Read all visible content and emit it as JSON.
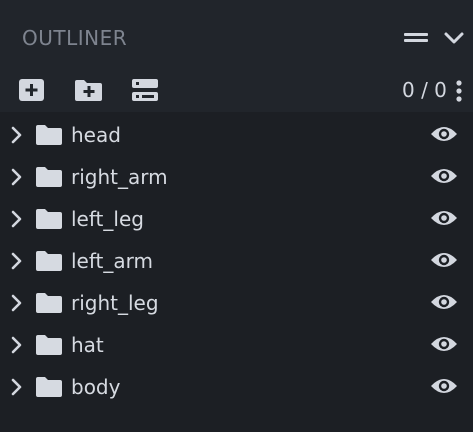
{
  "panel": {
    "title": "OUTLINER",
    "counter": "0 / 0"
  },
  "toolbar": {
    "icons": [
      "add-cube-icon",
      "add-group-icon",
      "sort-icon",
      "more-vertical-icon"
    ]
  },
  "tree": {
    "items": [
      {
        "label": "head"
      },
      {
        "label": "right_arm"
      },
      {
        "label": "left_leg"
      },
      {
        "label": "left_arm"
      },
      {
        "label": "right_leg"
      },
      {
        "label": "hat"
      },
      {
        "label": "body"
      }
    ]
  },
  "colors": {
    "background": "#21252b",
    "tree_background": "#1c1f24",
    "text": "#d6dae1",
    "muted_text": "#7e848f",
    "icon": "#d3d7df"
  }
}
